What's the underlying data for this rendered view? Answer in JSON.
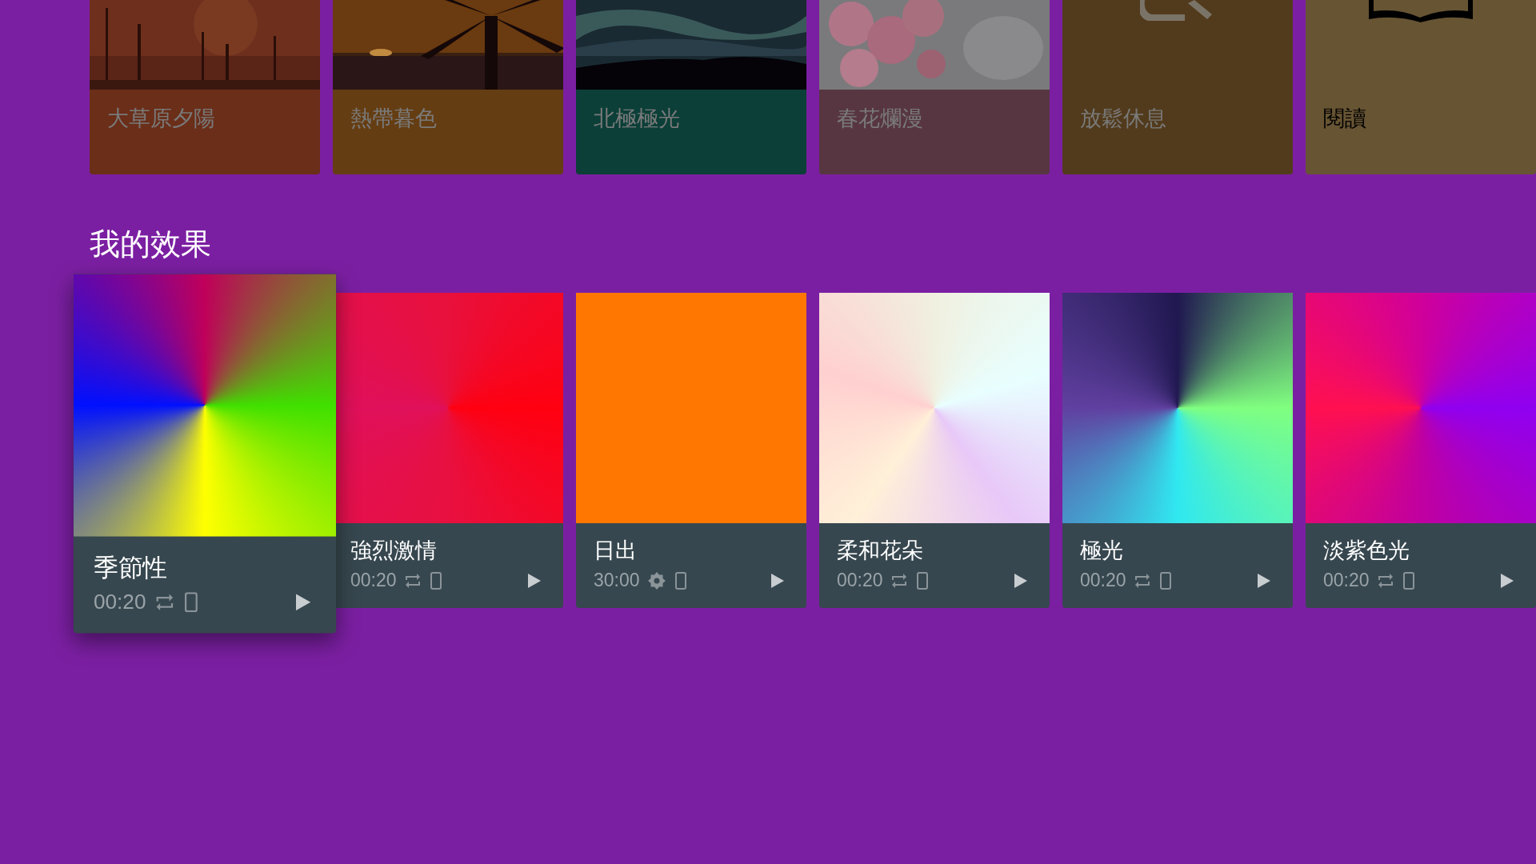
{
  "scenes": [
    {
      "kind": "picture",
      "title": "大草原夕陽",
      "color": "#6a2e19"
    },
    {
      "kind": "picture",
      "title": "熱帶暮色",
      "color": "#653d12"
    },
    {
      "kind": "picture",
      "title": "北極極光",
      "color": "#0b3f38"
    },
    {
      "kind": "picture",
      "title": "春花爛漫",
      "color": "#573642"
    },
    {
      "kind": "relax",
      "title": "放鬆休息",
      "color": "#523b1c"
    },
    {
      "kind": "book",
      "title": "閱讀",
      "color": "#675433"
    }
  ],
  "section_title": "我的效果",
  "effects": [
    {
      "title": "季節性",
      "duration": "00:20",
      "kind": "repeat",
      "selected": true
    },
    {
      "title": "強烈激情",
      "duration": "00:20",
      "kind": "repeat",
      "selected": false
    },
    {
      "title": "日出",
      "duration": "30:00",
      "kind": "brightness",
      "selected": false
    },
    {
      "title": "柔和花朵",
      "duration": "00:20",
      "kind": "repeat",
      "selected": false
    },
    {
      "title": "極光",
      "duration": "00:20",
      "kind": "repeat",
      "selected": false
    },
    {
      "title": "淡紫色光",
      "duration": "00:20",
      "kind": "repeat",
      "selected": false
    }
  ]
}
